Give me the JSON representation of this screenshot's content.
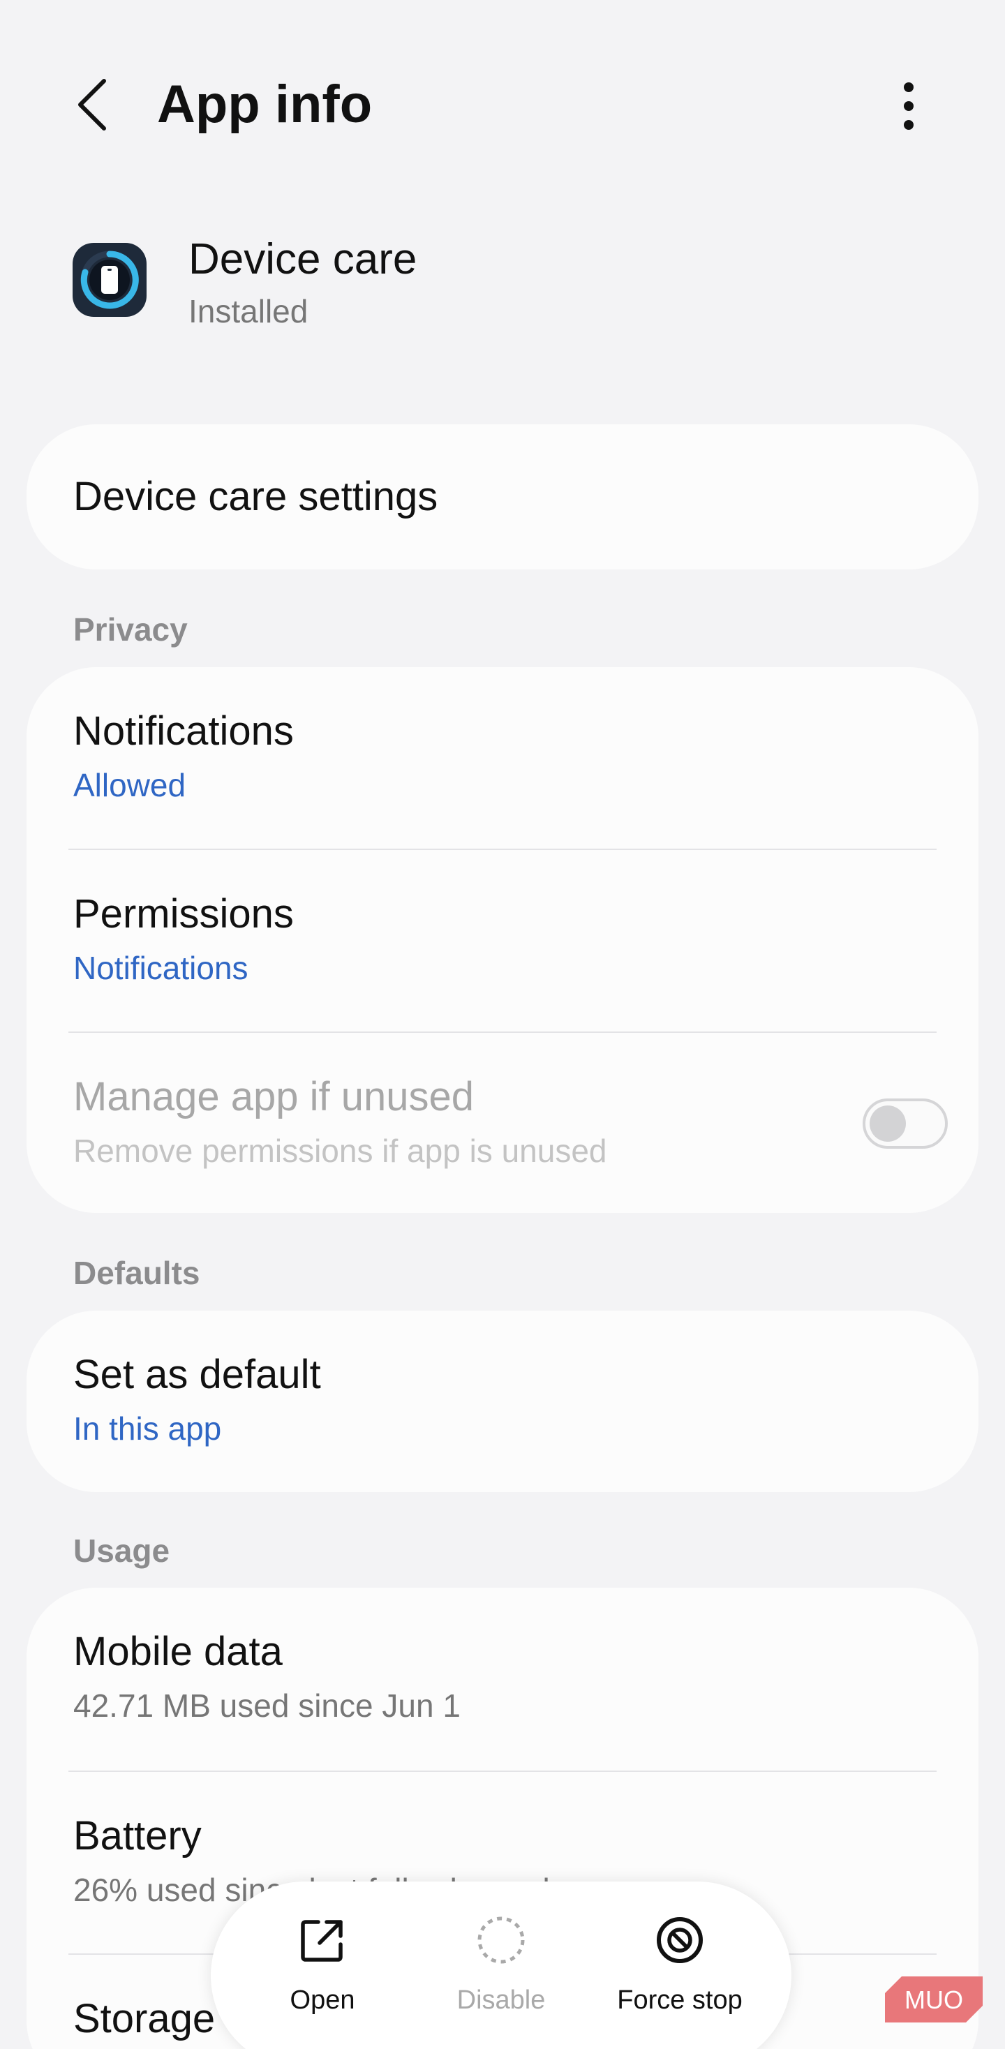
{
  "header": {
    "title": "App info",
    "back_icon": "chevron-left-icon",
    "more_icon": "more-vertical-icon"
  },
  "app": {
    "name": "Device care",
    "status": "Installed",
    "icon": "device-care-icon"
  },
  "settings_card": {
    "title": "Device care settings"
  },
  "privacy": {
    "label": "Privacy",
    "notifications": {
      "title": "Notifications",
      "sub": "Allowed"
    },
    "permissions": {
      "title": "Permissions",
      "sub": "Notifications"
    },
    "manage_unused": {
      "title": "Manage app if unused",
      "sub": "Remove permissions if app is unused",
      "toggle_on": false
    }
  },
  "defaults": {
    "label": "Defaults",
    "set_default": {
      "title": "Set as default",
      "sub": "In this app"
    }
  },
  "usage": {
    "label": "Usage",
    "mobile_data": {
      "title": "Mobile data",
      "sub": "42.71 MB used since Jun 1"
    },
    "battery": {
      "title": "Battery",
      "sub": "26% used since last fully charged"
    },
    "storage": {
      "title": "Storage"
    }
  },
  "action_bar": {
    "open": {
      "label": "Open",
      "icon": "open-external-icon"
    },
    "disable": {
      "label": "Disable",
      "icon": "disable-circle-icon"
    },
    "force_stop": {
      "label": "Force stop",
      "icon": "force-stop-icon"
    }
  },
  "watermark": {
    "text": "MUO"
  },
  "colors": {
    "background": "#f3f3f5",
    "card": "#fcfcfc",
    "accent_blue": "#2f66c4",
    "watermark": "#e8777a"
  }
}
